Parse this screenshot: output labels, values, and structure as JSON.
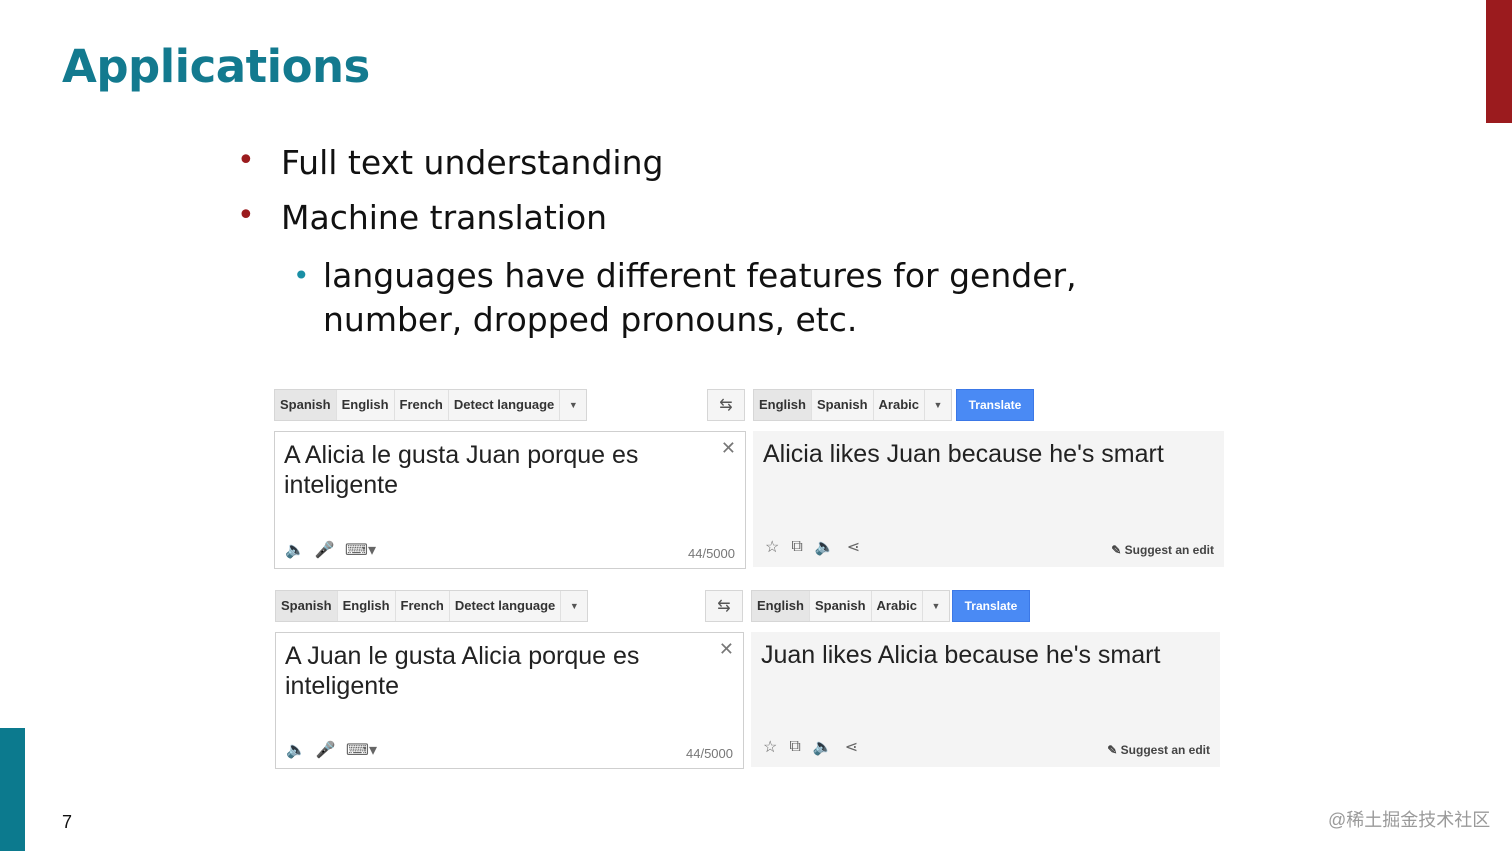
{
  "slide": {
    "title": "Applications",
    "bullets": [
      "Full text understanding",
      "Machine translation"
    ],
    "sub_bullet": "languages have different features for gender, number, dropped pronouns, etc.",
    "page_number": "7",
    "watermark": "@稀土掘金技术社区",
    "colors": {
      "title": "#137a8f",
      "red_accent": "#9b1b1e",
      "teal_accent": "#0c7a8e"
    }
  },
  "translators": [
    {
      "source_langs": [
        "Spanish",
        "English",
        "French",
        "Detect language"
      ],
      "target_langs": [
        "English",
        "Spanish",
        "Arabic"
      ],
      "translate_label": "Translate",
      "source_text": "A Alicia le gusta Juan porque es inteligente",
      "output_text": "Alicia likes Juan because he's smart",
      "char_count": "44/5000",
      "suggest_label": "Suggest an edit"
    },
    {
      "source_langs": [
        "Spanish",
        "English",
        "French",
        "Detect language"
      ],
      "target_langs": [
        "English",
        "Spanish",
        "Arabic"
      ],
      "translate_label": "Translate",
      "source_text": "A Juan le gusta Alicia porque es inteligente",
      "output_text": "Juan likes Alicia because he's smart",
      "char_count": "44/5000",
      "suggest_label": "Suggest an edit"
    }
  ]
}
